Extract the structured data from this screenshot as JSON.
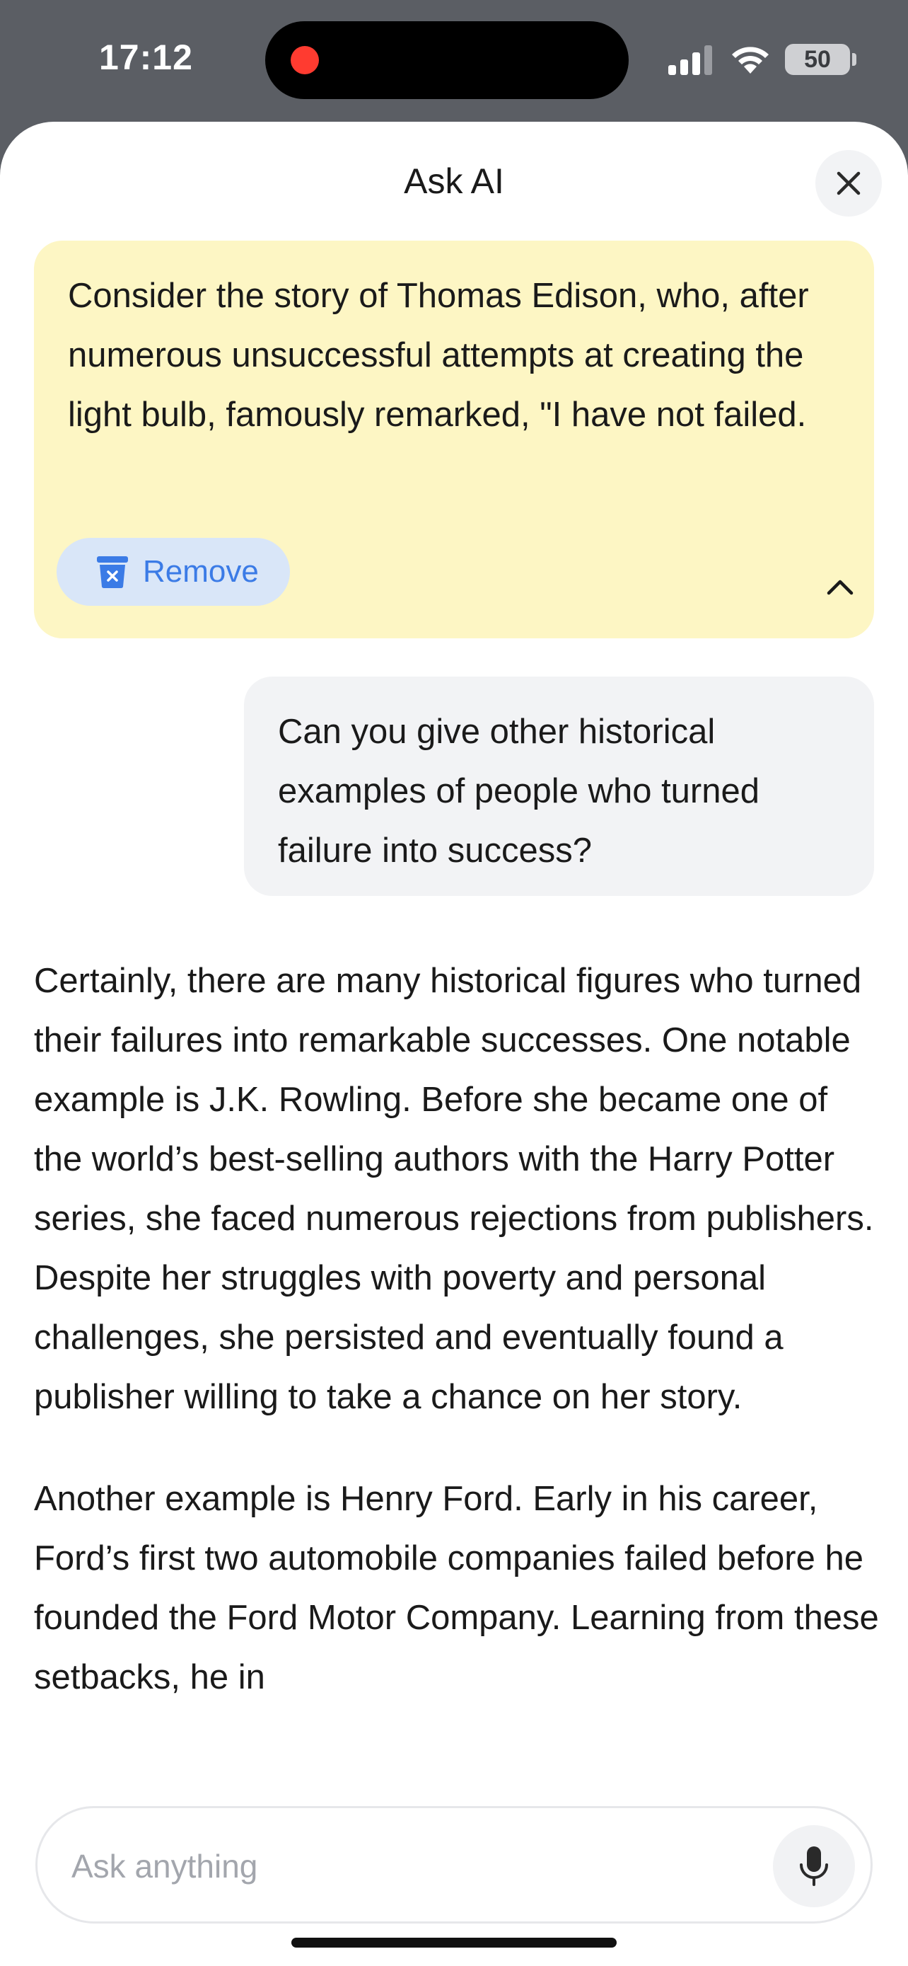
{
  "status_bar": {
    "time": "17:12",
    "battery": "50"
  },
  "sheet": {
    "title": "Ask AI"
  },
  "quote_card": {
    "text": "Consider the story of Thomas Edison, who, after numerous unsuccessful attempts at creating the light bulb, famously remarked, \"I have not failed.",
    "remove_label": "Remove"
  },
  "user_message": {
    "text": "Can you give other historical examples of people who turned failure into success?"
  },
  "answer": {
    "paragraphs": [
      "Certainly, there are many historical figures who turned their failures into remarkable successes.  One notable example is J.K. Rowling.  Before she became one of the world’s best-selling authors with the Harry Potter series, she faced numerous rejections from publishers.  Despite her struggles with poverty and personal challenges, she persisted and eventually found a publisher willing to take a chance on her story.",
      "Another example is Henry Ford.  Early in his career, Ford’s first two automobile companies failed before he founded the Ford Motor Company.  Learning from these setbacks, he in"
    ]
  },
  "input": {
    "placeholder": "Ask anything"
  },
  "colors": {
    "quote_bg": "#fdf6c4",
    "remove_bg": "#d9e6f8",
    "accent_blue": "#3b7be6",
    "bubble_bg": "#f2f3f5",
    "record_red": "#ff3b30"
  }
}
